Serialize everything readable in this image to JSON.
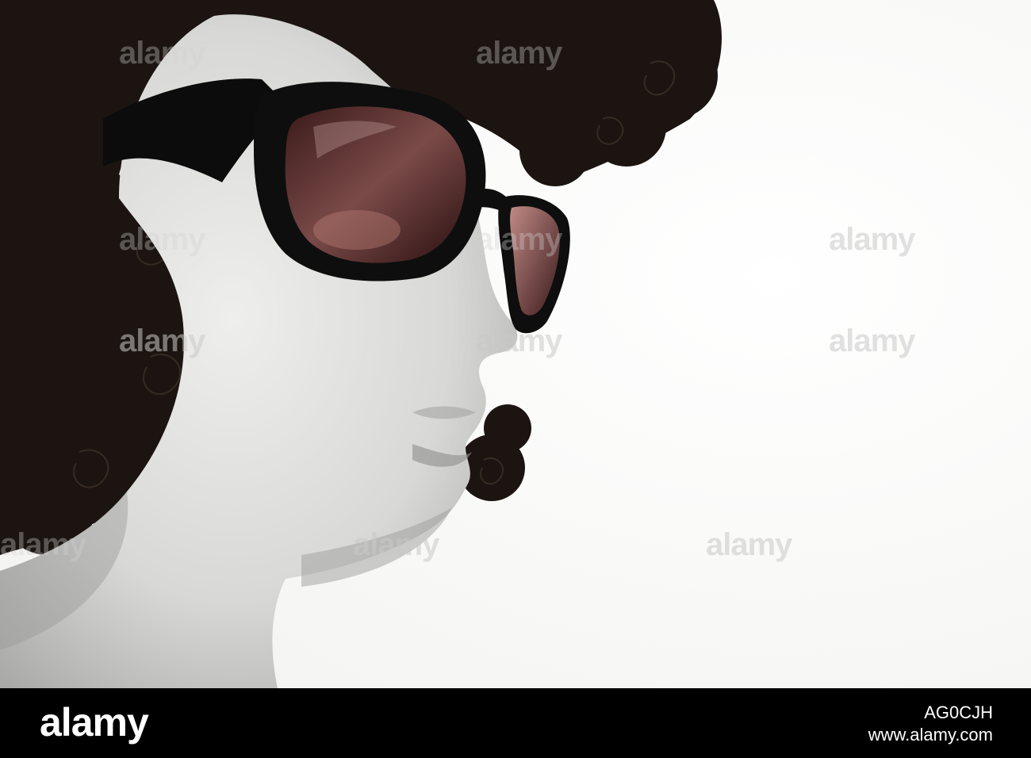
{
  "photo": {
    "description_icon": "mannequin-head-with-sunglasses"
  },
  "watermark": {
    "text": "alamy"
  },
  "footer": {
    "logo": "alamy",
    "image_code": "AG0CJH",
    "site": "www.alamy.com"
  }
}
